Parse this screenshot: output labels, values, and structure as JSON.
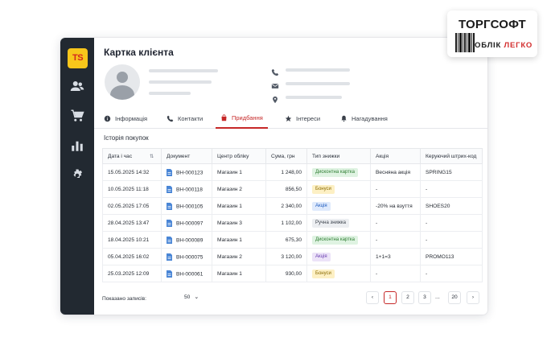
{
  "brand": {
    "line1": "ТОРГСОФТ",
    "line2a": "ОБЛІК",
    "line2b": "ЛЕГКО"
  },
  "app": {
    "logo": "TS",
    "title": "Картка клієнта"
  },
  "sidebar": {
    "icons": [
      "users-icon",
      "cart-icon",
      "chart-icon",
      "gear-icon"
    ]
  },
  "tabs": [
    {
      "label": "Інформація",
      "icon": "info-icon"
    },
    {
      "label": "Контакти",
      "icon": "phone-icon"
    },
    {
      "label": "Придбання",
      "icon": "bag-icon",
      "active": true
    },
    {
      "label": "Інтереси",
      "icon": "star-icon"
    },
    {
      "label": "Нагадування",
      "icon": "bell-icon"
    }
  ],
  "purchases": {
    "title": "Історія покупок",
    "columns": [
      "Дата і час",
      "Документ",
      "Центр обліку",
      "Сума, грн",
      "Тип знижки",
      "Акція",
      "Керуючий штрих-код"
    ],
    "rows": [
      {
        "date": "15.05.2025 14:32",
        "doc": "ВН-000123",
        "center": "Магазин 1",
        "sum": "1 248,00",
        "discount": "Дисконтна картка",
        "promo": "Весняна акція",
        "barcode": "SPRING15"
      },
      {
        "date": "10.05.2025 11:18",
        "doc": "ВН-000118",
        "center": "Магазин 2",
        "sum": "856,50",
        "discount": "Бонуси",
        "promo": "-",
        "barcode": "-"
      },
      {
        "date": "02.05.2025 17:05",
        "doc": "ВН-000105",
        "center": "Магазин 1",
        "sum": "2 340,00",
        "discount": "Акція",
        "promo": "-20% на взуття",
        "barcode": "SHOES20"
      },
      {
        "date": "28.04.2025 13:47",
        "doc": "ВН-000097",
        "center": "Магазин 3",
        "sum": "1 102,00",
        "discount": "Ручна знижка",
        "promo": "-",
        "barcode": "-"
      },
      {
        "date": "18.04.2025 10:21",
        "doc": "ВН-000089",
        "center": "Магазин 1",
        "sum": "675,30",
        "discount": "Дисконтна картка",
        "promo": "-",
        "barcode": "-"
      },
      {
        "date": "05.04.2025 16:02",
        "doc": "ВН-000075",
        "center": "Магазин 2",
        "sum": "3 120,00",
        "discount": "Акція",
        "promo": "1+1=3",
        "barcode": "PROMO113"
      },
      {
        "date": "25.03.2025 12:09",
        "doc": "ВН-000061",
        "center": "Магазин 1",
        "sum": "930,00",
        "discount": "Бонуси",
        "promo": "-",
        "barcode": "-"
      }
    ]
  },
  "badge_colors": {
    "Дисконтна картка": {
      "bg": "#dff3e2",
      "fg": "#2e7d32"
    },
    "Бонуси": {
      "bg": "#fdf0c4",
      "fg": "#8a6a00"
    },
    "Акція": {
      "bg": "#dfeafc",
      "fg": "#1d5bbf"
    },
    "Ручна знижка": {
      "bg": "#eceef1",
      "fg": "#3a404a"
    }
  },
  "badge_colors_alt": {
    "row6": {
      "bg": "#ece3f8",
      "fg": "#6a3fb0"
    }
  },
  "footer": {
    "label": "Показано записів:",
    "page_size": "50"
  },
  "pagination": {
    "pages": [
      "1",
      "2",
      "3",
      "20"
    ],
    "dots": "...",
    "current": "1"
  }
}
